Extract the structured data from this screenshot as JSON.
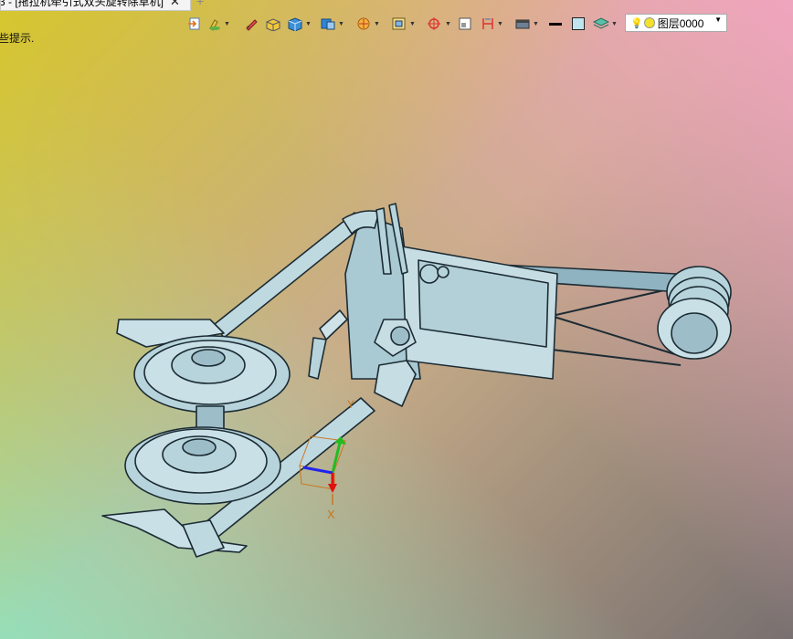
{
  "document_tab": {
    "title": "3 - [拖拉机牵引式双头旋转除草机]",
    "close_glyph": "✕",
    "new_tab_glyph": "+"
  },
  "status_hint": "些提示.",
  "toolbar": {
    "icons": [
      "export-icon",
      "paint-icon",
      "pen-icon",
      "box-color-icon",
      "solid-view-icon",
      "shade-mode-icon",
      "render-icon",
      "display-mode-icon",
      "snap-icon",
      "window-frame-icon",
      "fit-icon",
      "section-icon",
      "line-color-icon",
      "fill-color-icon",
      "layer-manager-icon"
    ]
  },
  "layer_selector": {
    "value": "图层0000"
  },
  "axis_triad": {
    "x_label": "X",
    "y_label": "Y"
  },
  "colors": {
    "model_fill": "#b7d4dc",
    "model_stroke": "#1c2b33",
    "axis_x": "#e01010",
    "axis_y": "#22bb22",
    "axis_z": "#2222ee"
  }
}
